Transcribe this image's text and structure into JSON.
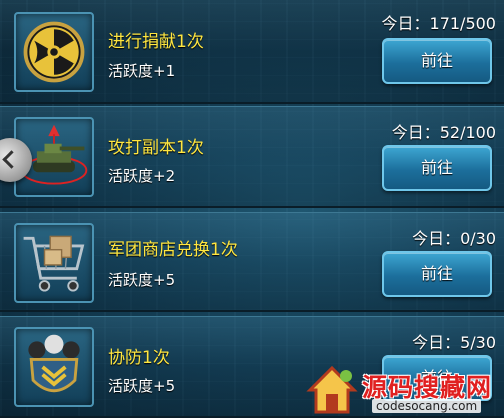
{
  "tasks": [
    {
      "title": "进行捐献1次",
      "reward": "活跃度+1",
      "progress": "今日：171/500",
      "button": "前往",
      "icon": "radiation-icon"
    },
    {
      "title": "攻打副本1次",
      "reward": "活跃度+2",
      "progress": "今日：52/100",
      "button": "前往",
      "icon": "tank-icon"
    },
    {
      "title": "军团商店兑换1次",
      "reward": "活跃度+5",
      "progress": "今日：0/30",
      "button": "前往",
      "icon": "shopping-cart-icon"
    },
    {
      "title": "协防1次",
      "reward": "活跃度+5",
      "progress": "今日：5/30",
      "button": "前往",
      "icon": "shield-icon"
    }
  ],
  "watermark": {
    "name": "源码搜藏网",
    "url": "codesocang.com"
  },
  "colors": {
    "title": "#ffe640",
    "button": "#1c6f9c",
    "watermark": "#e02020"
  }
}
